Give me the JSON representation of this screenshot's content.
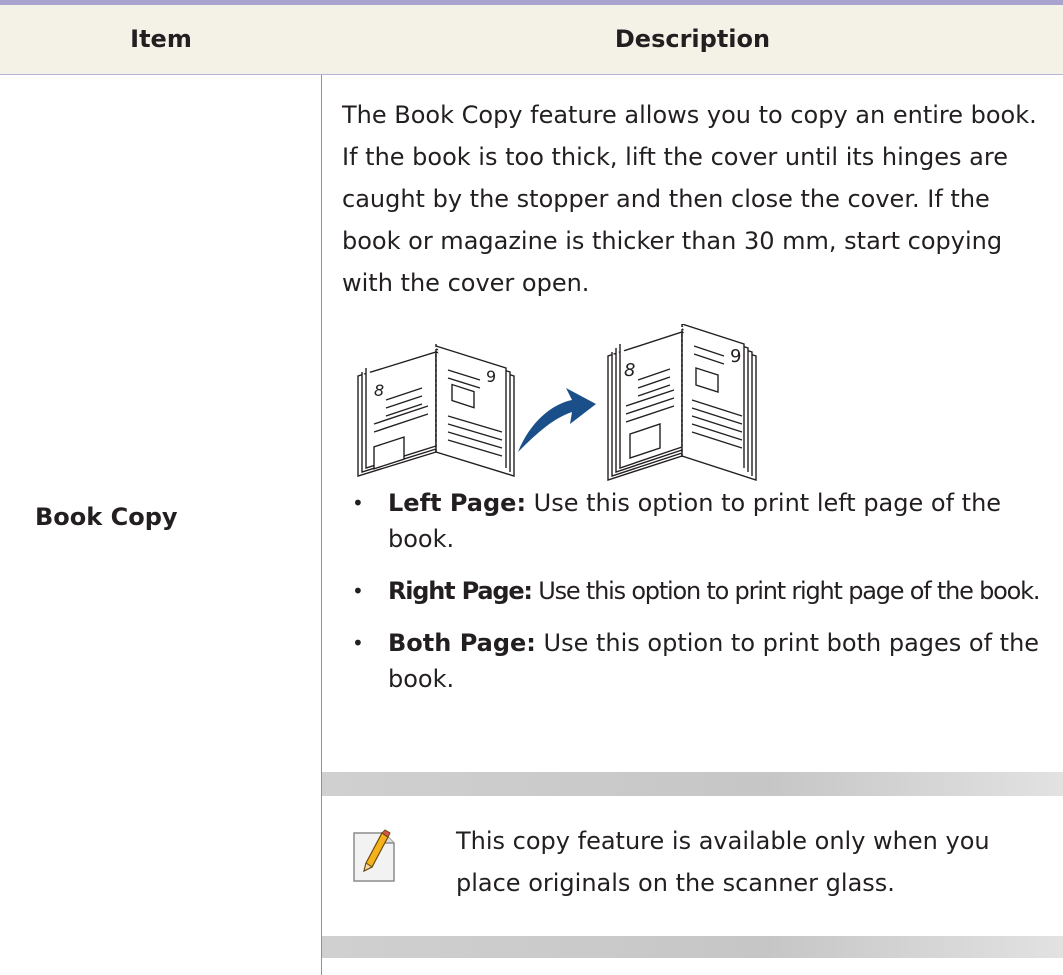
{
  "table": {
    "header": {
      "item": "Item",
      "description": "Description"
    },
    "row": {
      "item_label": "Book Copy",
      "intro": "The Book Copy feature allows you to copy an entire book. If the book is too thick, lift the cover until its hinges are caught by the stopper and then close the cover. If the book or magazine is thicker than 30 mm, start copying with the cover open.",
      "bullets": [
        {
          "term": "Left Page:",
          "text": " Use this option to print left page of the book."
        },
        {
          "term": "Right Page:",
          "text": " Use this option to print right page of the book."
        },
        {
          "term": "Both Page:",
          "text": " Use this option to print both pages of the book."
        }
      ],
      "note": "This copy feature is available only when you place originals on the scanner glass."
    }
  },
  "illustration": {
    "left_book_numbers": [
      "8",
      "9"
    ],
    "right_book_numbers": [
      "8",
      "9"
    ],
    "arrow_color": "#1b4f8a"
  },
  "colors": {
    "top_rule": "#a9a4cf",
    "header_bg": "#f4f2e7",
    "divider": "#8f8bbf",
    "note_band": "#c6c6c6"
  },
  "icons": {
    "note": "note-pencil-icon"
  }
}
